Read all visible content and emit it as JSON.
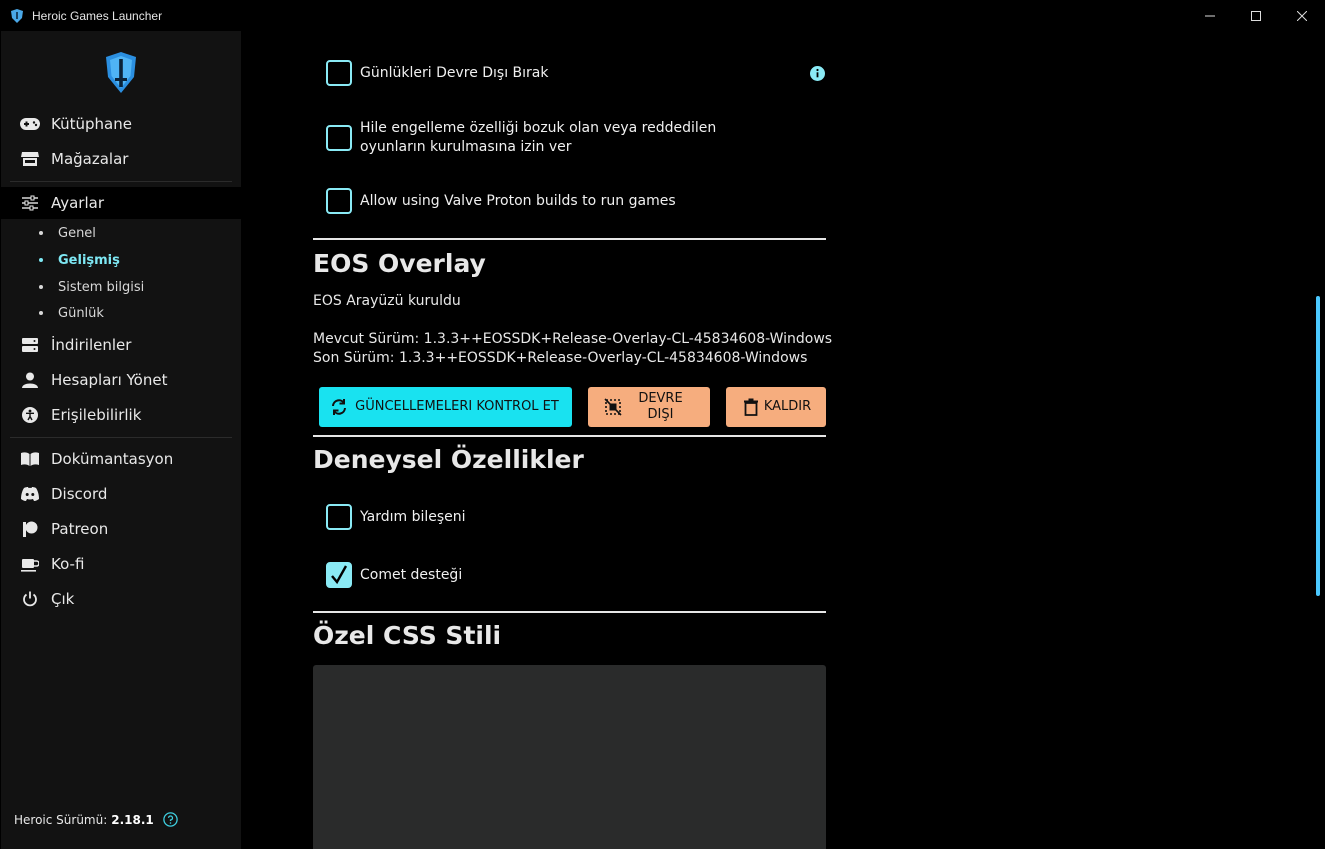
{
  "window": {
    "title": "Heroic Games Launcher",
    "minimize_icon": "minimize-icon",
    "maximize_icon": "maximize-icon",
    "close_icon": "close-icon"
  },
  "sidebar": {
    "logo_icon": "heroic-logo-icon",
    "items": [
      {
        "label": "Kütüphane",
        "icon": "gamepad-icon"
      },
      {
        "label": "Mağazalar",
        "icon": "store-icon"
      },
      {
        "label": "Ayarlar",
        "icon": "sliders-icon"
      },
      {
        "label": "İndirilenler",
        "icon": "server-icon"
      },
      {
        "label": "Hesapları Yönet",
        "icon": "user-icon"
      },
      {
        "label": "Erişilebilirlik",
        "icon": "accessibility-icon"
      },
      {
        "label": "Dokümantasyon",
        "icon": "book-icon"
      },
      {
        "label": "Discord",
        "icon": "discord-icon"
      },
      {
        "label": "Patreon",
        "icon": "patreon-icon"
      },
      {
        "label": "Ko-fi",
        "icon": "coffee-icon"
      },
      {
        "label": "Çık",
        "icon": "power-icon"
      }
    ],
    "settings_sub": [
      {
        "label": "Genel"
      },
      {
        "label": "Gelişmiş"
      },
      {
        "label": "Sistem bilgisi"
      },
      {
        "label": "Günlük"
      }
    ],
    "version_label": "Heroic Sürümü:",
    "version_value": "2.18.1"
  },
  "main": {
    "checkboxes_top": [
      {
        "label": "Günlükleri Devre Dışı Bırak",
        "checked": false
      },
      {
        "label": "Hile engelleme özelliği bozuk olan veya reddedilen oyunların kurulmasına izin ver",
        "checked": false
      },
      {
        "label": "Allow using Valve Proton builds to run games",
        "checked": false
      }
    ],
    "eos": {
      "title": "EOS Overlay",
      "status": "EOS Arayüzü kuruldu",
      "current_version": "Mevcut Sürüm: 1.3.3++EOSSDK+Release-Overlay-CL-45834608-Windows",
      "latest_version": "Son Sürüm: 1.3.3++EOSSDK+Release-Overlay-CL-45834608-Windows",
      "buttons": {
        "check_updates": "GÜNCELLEMELERI KONTROL ET",
        "disable": "DEVRE DIŞI",
        "remove": "KALDIR"
      }
    },
    "experimental": {
      "title": "Deneysel Özellikler",
      "checkboxes": [
        {
          "label": "Yardım bileşeni",
          "checked": false
        },
        {
          "label": "Comet desteği",
          "checked": true
        }
      ]
    },
    "custom_css": {
      "title": "Özel CSS Stili"
    }
  },
  "colors": {
    "accent": "#8aeaf5",
    "button_cyan": "#19e2f0",
    "button_orange": "#f6ad7e",
    "sidebar_bg": "#121212"
  }
}
